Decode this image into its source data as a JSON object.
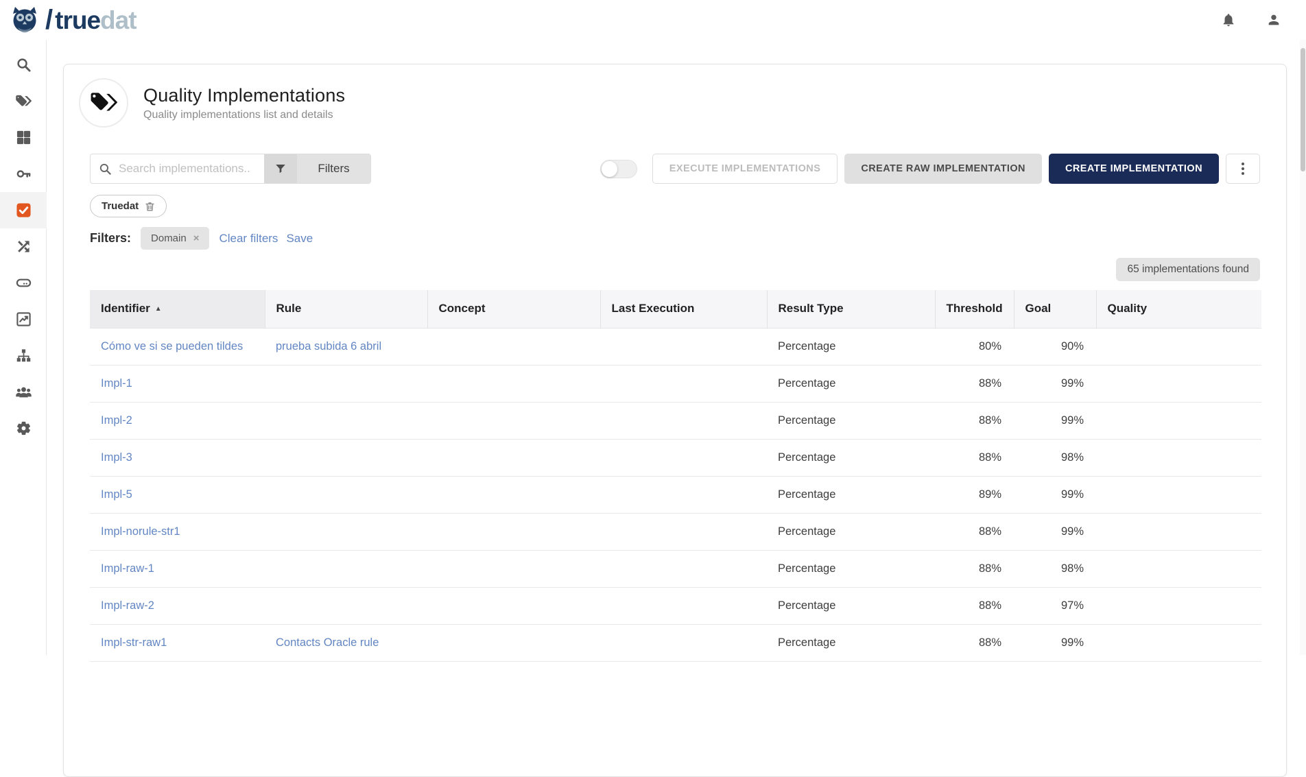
{
  "brand": {
    "slash": "/",
    "name_primary": "true",
    "name_secondary": "dat"
  },
  "page": {
    "title": "Quality Implementations",
    "subtitle": "Quality implementations list and details"
  },
  "toolbar": {
    "search_placeholder": "Search implementations..",
    "filters_button_label": "Filters",
    "execute_label": "EXECUTE IMPLEMENTATIONS",
    "create_raw_label": "CREATE RAW IMPLEMENTATION",
    "create_label": "CREATE IMPLEMENTATION"
  },
  "active_tag": {
    "label": "Truedat"
  },
  "filters_bar": {
    "label": "Filters:",
    "chips": [
      {
        "label": "Domain",
        "remove": "×"
      }
    ],
    "clear_label": "Clear filters",
    "save_label": "Save"
  },
  "results_badge": {
    "label": "65 implementations found"
  },
  "table": {
    "columns": [
      {
        "key": "identifier",
        "label": "Identifier",
        "sorted": "asc"
      },
      {
        "key": "rule",
        "label": "Rule"
      },
      {
        "key": "concept",
        "label": "Concept"
      },
      {
        "key": "last_execution",
        "label": "Last Execution"
      },
      {
        "key": "result_type",
        "label": "Result Type"
      },
      {
        "key": "threshold",
        "label": "Threshold"
      },
      {
        "key": "goal",
        "label": "Goal"
      },
      {
        "key": "quality",
        "label": "Quality"
      }
    ],
    "rows": [
      {
        "identifier": "Cómo ve si se pueden tildes",
        "rule": "prueba subida 6 abril",
        "concept": "",
        "last_execution": "",
        "result_type": "Percentage",
        "threshold": "80%",
        "goal": "90%",
        "quality": ""
      },
      {
        "identifier": "Impl-1",
        "rule": "",
        "concept": "",
        "last_execution": "",
        "result_type": "Percentage",
        "threshold": "88%",
        "goal": "99%",
        "quality": ""
      },
      {
        "identifier": "Impl-2",
        "rule": "",
        "concept": "",
        "last_execution": "",
        "result_type": "Percentage",
        "threshold": "88%",
        "goal": "99%",
        "quality": ""
      },
      {
        "identifier": "Impl-3",
        "rule": "",
        "concept": "",
        "last_execution": "",
        "result_type": "Percentage",
        "threshold": "88%",
        "goal": "98%",
        "quality": ""
      },
      {
        "identifier": "Impl-5",
        "rule": "",
        "concept": "",
        "last_execution": "",
        "result_type": "Percentage",
        "threshold": "89%",
        "goal": "99%",
        "quality": ""
      },
      {
        "identifier": "Impl-norule-str1",
        "rule": "",
        "concept": "",
        "last_execution": "",
        "result_type": "Percentage",
        "threshold": "88%",
        "goal": "99%",
        "quality": ""
      },
      {
        "identifier": "Impl-raw-1",
        "rule": "",
        "concept": "",
        "last_execution": "",
        "result_type": "Percentage",
        "threshold": "88%",
        "goal": "98%",
        "quality": ""
      },
      {
        "identifier": "Impl-raw-2",
        "rule": "",
        "concept": "",
        "last_execution": "",
        "result_type": "Percentage",
        "threshold": "88%",
        "goal": "97%",
        "quality": ""
      },
      {
        "identifier": "Impl-str-raw1",
        "rule": "Contacts Oracle rule",
        "concept": "",
        "last_execution": "",
        "result_type": "Percentage",
        "threshold": "88%",
        "goal": "99%",
        "quality": ""
      }
    ]
  },
  "colors": {
    "accent_navy": "#1b2b57",
    "link_blue": "#6286c3",
    "active_orange": "#e2571f"
  }
}
